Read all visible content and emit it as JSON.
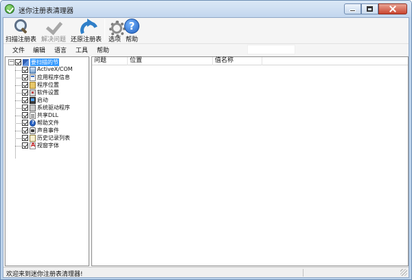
{
  "window": {
    "title": "迷你注册表清理器"
  },
  "toolbar": {
    "scan": "扫描注册表",
    "fix": "解决问题",
    "restore": "还原注册表",
    "options": "选项",
    "help": "帮助"
  },
  "menu": {
    "file": "文件",
    "edit": "编辑",
    "language": "语言",
    "tools": "工具",
    "help": "帮助"
  },
  "tree": {
    "root": "要扫描的节",
    "items": [
      {
        "label": "ActiveX/COM",
        "icon": "activex-icon",
        "checked": true
      },
      {
        "label": "应用程序信息",
        "icon": "app-info-icon",
        "checked": true
      },
      {
        "label": "程序位置",
        "icon": "program-location-icon",
        "checked": true
      },
      {
        "label": "软件设置",
        "icon": "software-settings-icon",
        "checked": true
      },
      {
        "label": "启动",
        "icon": "startup-icon",
        "checked": true
      },
      {
        "label": "系统驱动程序",
        "icon": "system-driver-icon",
        "checked": true
      },
      {
        "label": "共享DLL",
        "icon": "shared-dll-icon",
        "checked": true
      },
      {
        "label": "帮助文件",
        "icon": "help-file-icon",
        "checked": true
      },
      {
        "label": "声音事件",
        "icon": "sound-event-icon",
        "checked": true
      },
      {
        "label": "历史记录列表",
        "icon": "history-list-icon",
        "checked": true
      },
      {
        "label": "视窗字体",
        "icon": "windows-font-icon",
        "checked": true
      }
    ]
  },
  "list": {
    "columns": [
      "问题",
      "位置",
      "值名称"
    ]
  },
  "status": {
    "text": "欢迎来到迷你注册表清理器!"
  },
  "colors": {
    "selection": "#3399ff",
    "titlebar": "#c2d6ee",
    "close": "#c9442f"
  }
}
